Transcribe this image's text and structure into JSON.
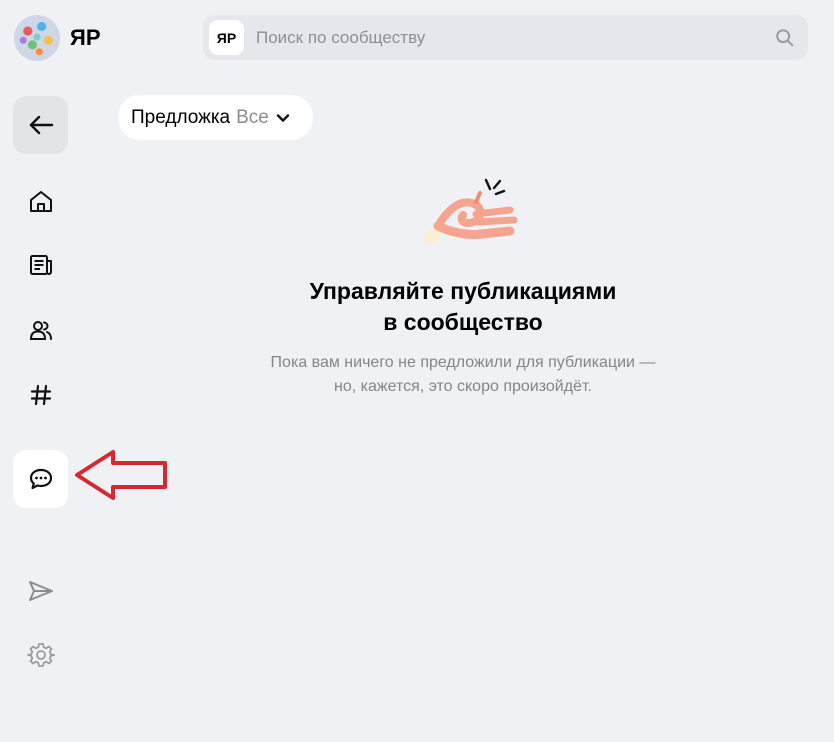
{
  "header": {
    "community_name": "ЯР",
    "search": {
      "badge": "ЯР",
      "placeholder": "Поиск по сообществу",
      "icon": "search-icon"
    }
  },
  "sidebar": {
    "items": [
      {
        "name": "back",
        "icon": "arrow-left-icon"
      },
      {
        "name": "home",
        "icon": "home-icon"
      },
      {
        "name": "feed",
        "icon": "newspaper-icon"
      },
      {
        "name": "members",
        "icon": "people-icon"
      },
      {
        "name": "tags",
        "icon": "hash-icon"
      },
      {
        "name": "suggestions",
        "icon": "chat-bubble-icon",
        "active": true
      },
      {
        "name": "send",
        "icon": "paper-plane-icon"
      },
      {
        "name": "settings",
        "icon": "gear-icon"
      }
    ]
  },
  "filter": {
    "label": "Предложка",
    "value": "Все"
  },
  "empty_state": {
    "illustration": "ok-hand-icon",
    "title_line1": "Управляйте публикациями",
    "title_line2": "в сообщество",
    "text_line1": "Пока вам ничего не предложили для публикации —",
    "text_line2": "но, кажется, это скоро произойдёт."
  },
  "annotation": {
    "arrow_color": "#d42a2f"
  },
  "colors": {
    "background": "#f0f1f5",
    "text_muted": "#83858b"
  }
}
